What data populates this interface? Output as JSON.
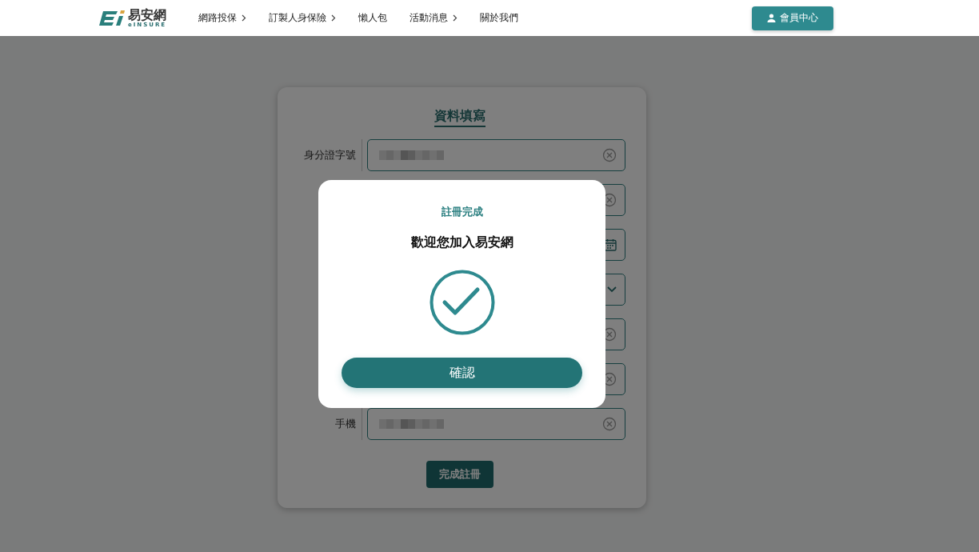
{
  "header": {
    "logo": {
      "name": "易安網",
      "subtitle": "eINSURE"
    },
    "nav": [
      {
        "label": "網路投保",
        "has_submenu": true
      },
      {
        "label": "訂製人身保險",
        "has_submenu": true
      },
      {
        "label": "懶人包",
        "has_submenu": false
      },
      {
        "label": "活動消息",
        "has_submenu": true
      },
      {
        "label": "關於我們",
        "has_submenu": false
      }
    ],
    "member_button": "會員中心"
  },
  "form": {
    "title": "資料填寫",
    "fields": [
      {
        "label": "身分證字號",
        "kind": "text",
        "value_masked": true
      },
      {
        "kind": "text",
        "value_masked": false
      },
      {
        "kind": "date",
        "value_masked": false
      },
      {
        "kind": "select",
        "value_masked": false
      },
      {
        "kind": "text",
        "value_masked": false
      },
      {
        "kind": "text",
        "value_masked": false
      },
      {
        "label": "手機",
        "kind": "text",
        "value_masked": true
      }
    ],
    "submit": "完成註冊"
  },
  "dialog": {
    "title": "註冊完成",
    "message": "歡迎您加入易安網",
    "confirm": "確認"
  }
}
